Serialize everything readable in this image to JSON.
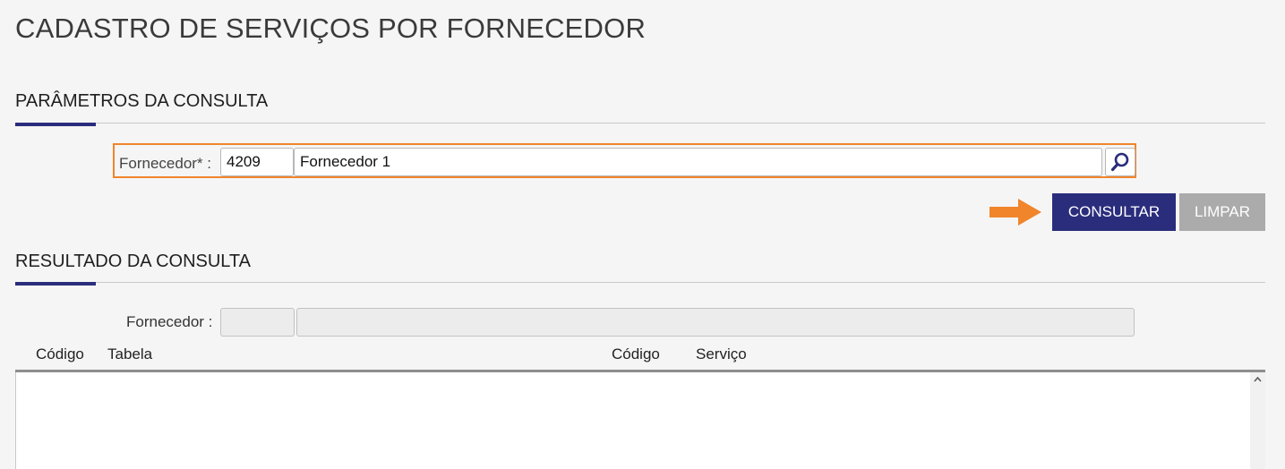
{
  "page": {
    "title": "CADASTRO DE SERVIÇOS POR FORNECEDOR"
  },
  "params_section": {
    "title": "PARÂMETROS DA CONSULTA",
    "supplier_label": "Fornecedor* :",
    "supplier_code_value": "4209",
    "supplier_name_value": "Fornecedor 1",
    "search_icon": "magnifier-icon"
  },
  "actions": {
    "consult_label": "CONSULTAR",
    "clear_label": "LIMPAR",
    "arrow_icon": "arrow-right-icon"
  },
  "result_section": {
    "title": "RESULTADO DA CONSULTA",
    "supplier_label": "Fornecedor :",
    "supplier_code_value": "",
    "supplier_name_value": "",
    "columns": [
      "Código",
      "Tabela",
      "Código",
      "Serviço"
    ],
    "rows": []
  },
  "colors": {
    "primary": "#2a2d7c",
    "highlight": "#f0852b",
    "disabled_button": "#ababab"
  }
}
